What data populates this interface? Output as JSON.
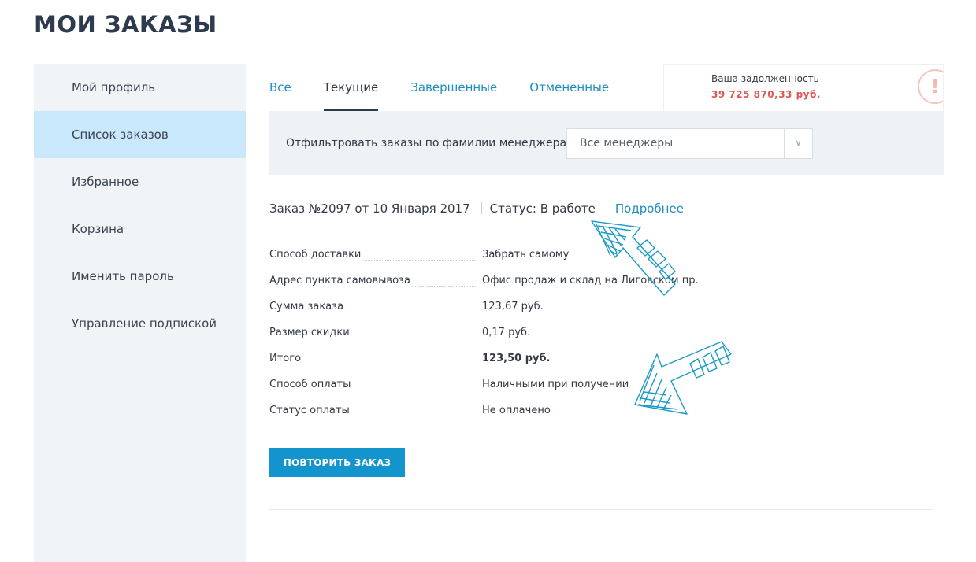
{
  "page": {
    "title": "МОИ ЗАКАЗЫ"
  },
  "sidebar": {
    "items": [
      {
        "label": "Мой профиль"
      },
      {
        "label": "Список заказов"
      },
      {
        "label": "Избранное"
      },
      {
        "label": "Корзина"
      },
      {
        "label": "Именить пароль"
      },
      {
        "label": "Управление подпиской"
      }
    ],
    "active_index": 1
  },
  "tabs": {
    "items": [
      {
        "label": "Все"
      },
      {
        "label": "Текущие"
      },
      {
        "label": "Завершенные"
      },
      {
        "label": "Отмененные"
      }
    ],
    "active_index": 1
  },
  "debt": {
    "label": "Ваша задолженность",
    "amount": "39 725 870,33 руб.",
    "alert_glyph": "!"
  },
  "filter": {
    "label": "Отфильтровать заказы по фамилии менеджера",
    "selected": "Все менеджеры"
  },
  "order": {
    "title": "Заказ №2097 от 10 Января 2017",
    "status": "Статус: В работе",
    "details_link": "Подробнее",
    "fields": [
      {
        "key": "Способ доставки",
        "value": "Забрать самому"
      },
      {
        "key": "Адрес пункта самовывоза",
        "value": "Офис продаж и склад на Лиговском пр."
      },
      {
        "key": "Сумма заказа",
        "value": "123,67 руб."
      },
      {
        "key": "Размер скидки",
        "value": "0,17 руб."
      },
      {
        "key": "Итого",
        "value": "123,50 руб."
      },
      {
        "key": "Способ оплаты",
        "value": "Наличными при получении"
      },
      {
        "key": "Статус оплаты",
        "value": "Не оплачено"
      }
    ],
    "repeat_button": "ПОВТОРИТЬ ЗАКАЗ"
  },
  "colors": {
    "accent": "#1f8dc2",
    "button": "#1394cd",
    "debt": "#e0574f",
    "sidebar_active": "#c9e8fb",
    "annotation": "#1b9ac7"
  }
}
